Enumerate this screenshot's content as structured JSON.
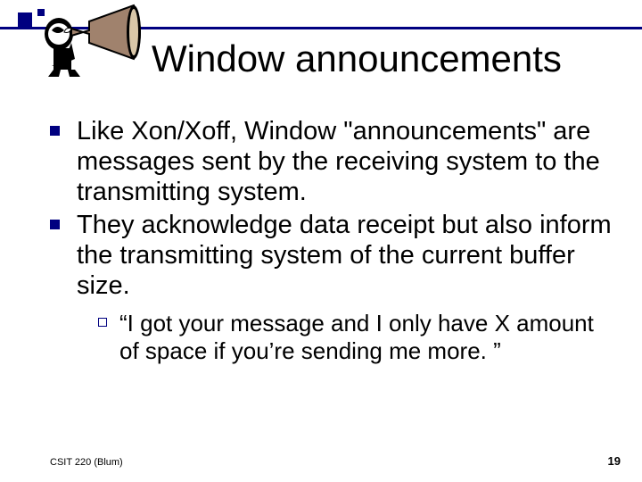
{
  "title": "Window announcements",
  "bullets": {
    "l1": [
      "Like Xon/Xoff, Window \"announcements\" are messages sent by the receiving system to the transmitting system.",
      "They acknowledge data receipt but also inform the transmitting system of the current buffer size."
    ],
    "l2": [
      "“I got your message and I only have X amount of space if you’re sending me more. ”"
    ]
  },
  "footer": {
    "left": "CSIT 220 (Blum)",
    "right": "19"
  }
}
